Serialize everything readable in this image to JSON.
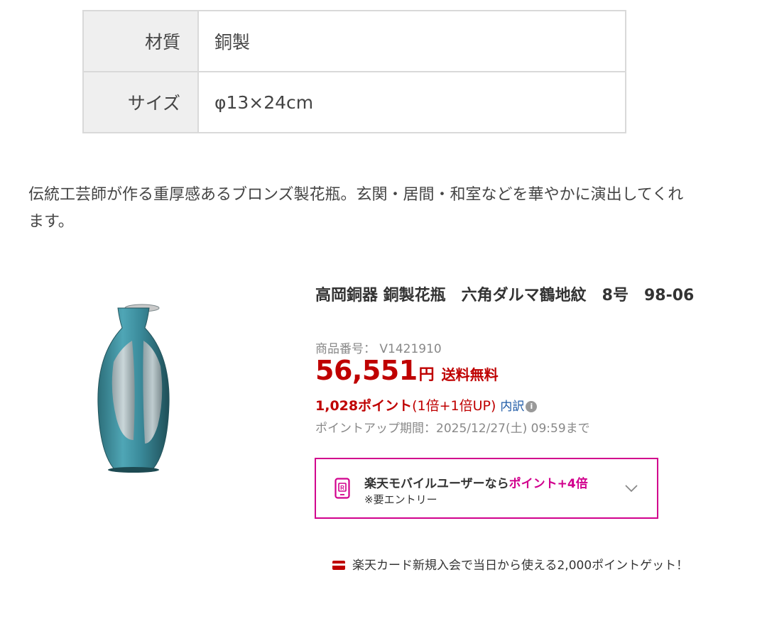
{
  "spec": {
    "rows": [
      {
        "label": "材質",
        "value": "銅製"
      },
      {
        "label": "サイズ",
        "value": "φ13×24cm"
      }
    ]
  },
  "description": "伝統工芸師が作る重厚感あるブロンズ製花瓶。玄関・居間・和室などを華やかに演出してくれます。",
  "product": {
    "title": "高岡銅器 銅製花瓶　六角ダルマ鶴地紋　8号　98-06",
    "code": "商品番号： V1421910",
    "price": "56,551",
    "currency": "円",
    "shipping": "送料無料",
    "points": "1,028ポイント",
    "points_rate": "(1倍+1倍UP)",
    "breakdown_link": "内訳",
    "info_icon": "info-icon",
    "point_period": "ポイントアップ期間：2025/12/27(土) 09:59まで"
  },
  "mobile_promo": {
    "text_prefix": "楽天モバイルユーザーなら",
    "text_highlight": "ポイント+4倍",
    "note": "※要エントリー",
    "icon": "mobile-phone-icon",
    "expand_icon": "chevron-down-icon"
  },
  "card_promo": {
    "text": "楽天カード新規入会で当日から使える2,000ポイントゲット！",
    "icon": "credit-card-icon"
  },
  "colors": {
    "price_red": "#bf0000",
    "mobile_pink": "#d1008d",
    "link_blue": "#1e5aa6"
  }
}
